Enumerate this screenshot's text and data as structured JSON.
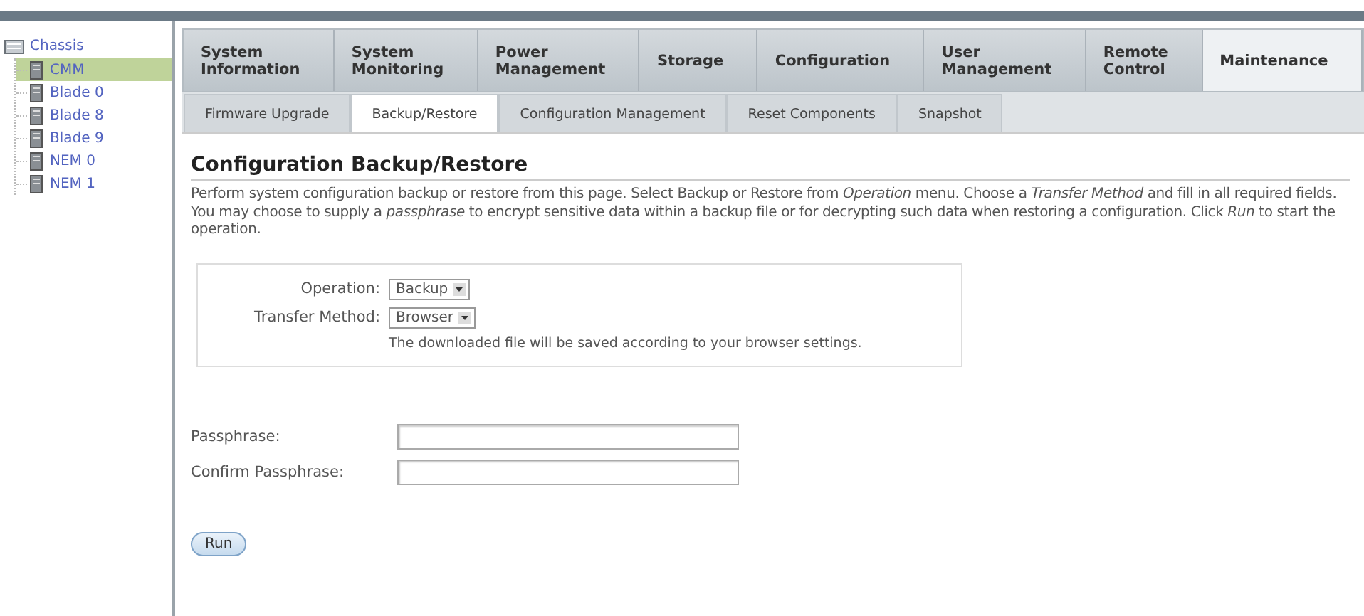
{
  "tree": {
    "label": "Chassis",
    "selected": false,
    "children": [
      {
        "label": "CMM",
        "selected": true
      },
      {
        "label": "Blade 0",
        "selected": false
      },
      {
        "label": "Blade 8",
        "selected": false
      },
      {
        "label": "Blade 9",
        "selected": false
      },
      {
        "label": "NEM 0",
        "selected": false
      },
      {
        "label": "NEM 1",
        "selected": false
      }
    ]
  },
  "main_tabs": [
    {
      "label": "System Information",
      "selected": false
    },
    {
      "label": "System Monitoring",
      "selected": false
    },
    {
      "label": "Power Management",
      "selected": false
    },
    {
      "label": "Storage",
      "selected": false
    },
    {
      "label": "Configuration",
      "selected": false
    },
    {
      "label": "User Management",
      "selected": false
    },
    {
      "label": "Remote Control",
      "selected": false
    },
    {
      "label": "Maintenance",
      "selected": true
    }
  ],
  "sub_tabs": [
    {
      "label": "Firmware Upgrade",
      "selected": false
    },
    {
      "label": "Backup/Restore",
      "selected": true
    },
    {
      "label": "Configuration Management",
      "selected": false
    },
    {
      "label": "Reset Components",
      "selected": false
    },
    {
      "label": "Snapshot",
      "selected": false
    }
  ],
  "heading": "Configuration Backup/Restore",
  "description": "Perform system configuration backup or restore from this page. Select Backup or Restore from *Operation* menu. Choose a *Transfer Method* and fill in all required fields. You may choose to supply a *passphrase* to encrypt sensitive data within a backup file or for decrypting such data when restoring a configuration. Click *Run* to start the operation.",
  "options": [
    {
      "label": "Operation:",
      "value": "Backup"
    },
    {
      "label": "Transfer Method:",
      "value": "Browser"
    }
  ],
  "note": "The downloaded file will be saved according to your browser settings.",
  "passphrase_fields": [
    {
      "label": "Passphrase:"
    },
    {
      "label": "Confirm Passphrase:"
    }
  ],
  "run_button": "Run"
}
